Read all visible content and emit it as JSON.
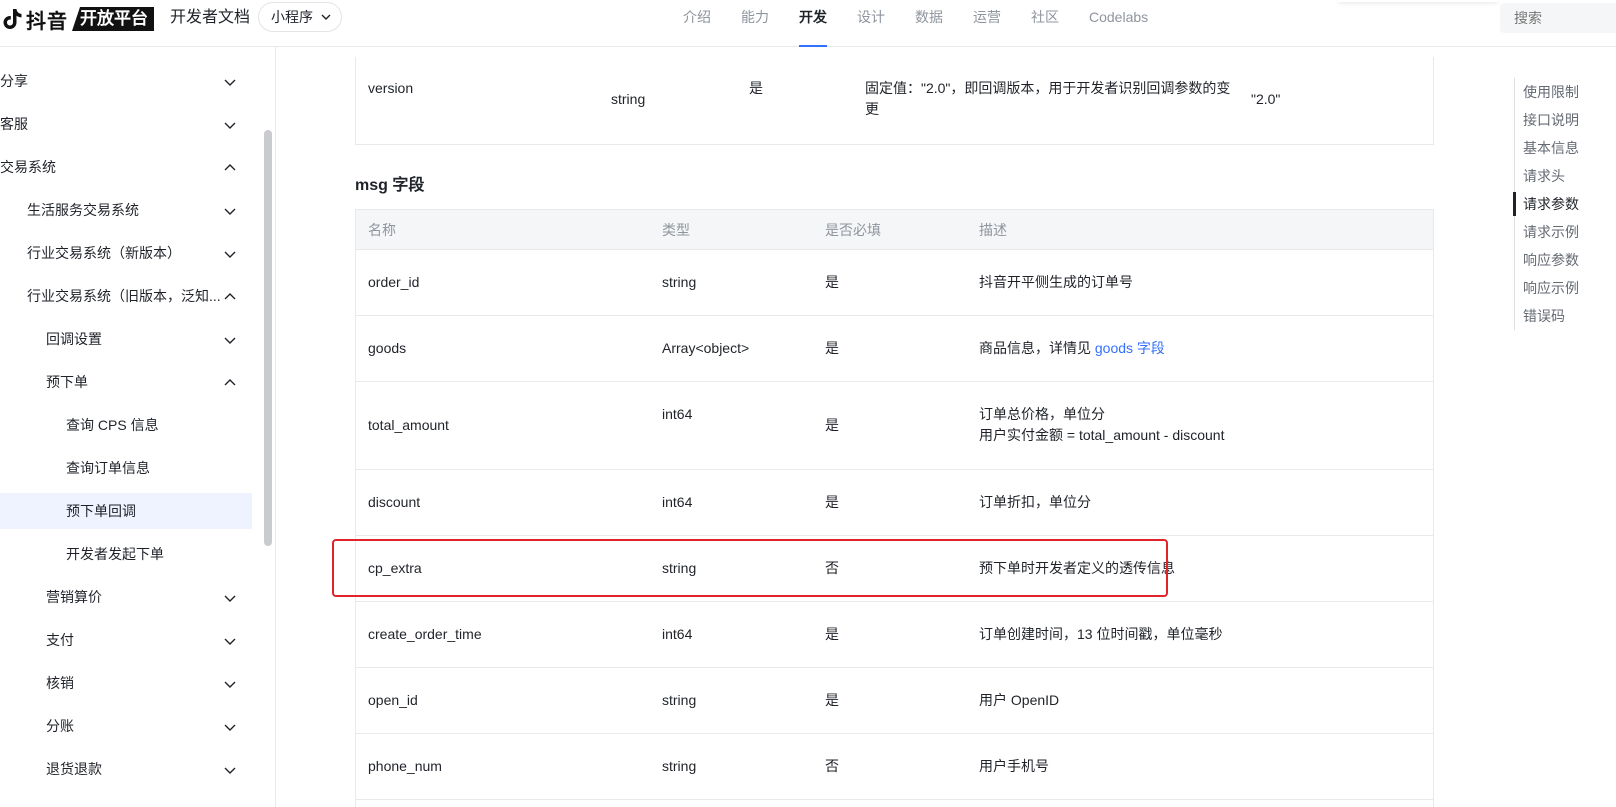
{
  "header": {
    "logo_text": "抖音",
    "logo_badge": "开放平台",
    "doc_title": "开发者文档",
    "product_select": "小程序",
    "nav": [
      {
        "label": "介绍",
        "active": false
      },
      {
        "label": "能力",
        "active": false
      },
      {
        "label": "开发",
        "active": true
      },
      {
        "label": "设计",
        "active": false
      },
      {
        "label": "数据",
        "active": false
      },
      {
        "label": "运营",
        "active": false
      },
      {
        "label": "社区",
        "active": false
      },
      {
        "label": "Codelabs",
        "active": false
      }
    ],
    "search_placeholder": "搜索"
  },
  "sidebar": {
    "items": [
      {
        "label": "分享",
        "expanded": false
      },
      {
        "label": "客服",
        "expanded": false
      },
      {
        "label": "交易系统",
        "expanded": true
      },
      {
        "label": "生活服务交易系统",
        "expanded": false
      },
      {
        "label": "行业交易系统（新版本）",
        "expanded": false
      },
      {
        "label": "行业交易系统（旧版本，泛知...",
        "expanded": true
      },
      {
        "label": "回调设置",
        "expanded": false
      },
      {
        "label": "预下单",
        "expanded": true
      },
      {
        "label": "查询 CPS 信息"
      },
      {
        "label": "查询订单信息"
      },
      {
        "label": "预下单回调",
        "selected": true
      },
      {
        "label": "开发者发起下单"
      },
      {
        "label": "营销算价",
        "expanded": false
      },
      {
        "label": "支付",
        "expanded": false
      },
      {
        "label": "核销",
        "expanded": false
      },
      {
        "label": "分账",
        "expanded": false
      },
      {
        "label": "退货退款",
        "expanded": false
      }
    ]
  },
  "top_row": {
    "name": "version",
    "type": "string",
    "required": "是",
    "desc_line1": "固定值：\"2.0\"，即回调版本，用于开发者识别回调参数的变",
    "desc_line2": "更",
    "example": "\"2.0\""
  },
  "msg_section": {
    "title": "msg 字段",
    "headers": [
      "名称",
      "类型",
      "是否必填",
      "描述"
    ],
    "rows": [
      {
        "name": "order_id",
        "type": "string",
        "required": "是",
        "desc": "抖音开平侧生成的订单号"
      },
      {
        "name": "goods",
        "type": "Array<object>",
        "required": "是",
        "desc": "商品信息，详情见 ",
        "link": "goods 字段"
      },
      {
        "name": "total_amount",
        "type": "int64",
        "required": "是",
        "desc": "订单总价格，单位分",
        "desc2": "用户实付金额 = total_amount - discount"
      },
      {
        "name": "discount",
        "type": "int64",
        "required": "是",
        "desc": "订单折扣，单位分"
      },
      {
        "name": "cp_extra",
        "type": "string",
        "required": "否",
        "desc": "预下单时开发者定义的透传信息"
      },
      {
        "name": "create_order_time",
        "type": "int64",
        "required": "是",
        "desc": "订单创建时间，13 位时间戳，单位毫秒"
      },
      {
        "name": "open_id",
        "type": "string",
        "required": "是",
        "desc": "用户 OpenID"
      },
      {
        "name": "phone_num",
        "type": "string",
        "required": "否",
        "desc": "用户手机号"
      }
    ]
  },
  "toc": {
    "items": [
      {
        "label": "使用限制"
      },
      {
        "label": "接口说明"
      },
      {
        "label": "基本信息"
      },
      {
        "label": "请求头"
      },
      {
        "label": "请求参数",
        "active": true
      },
      {
        "label": "请求示例"
      },
      {
        "label": "响应参数"
      },
      {
        "label": "响应示例"
      },
      {
        "label": "错误码"
      }
    ]
  },
  "colors": {
    "accent": "#3370ff",
    "highlight_box": "#e1242a",
    "selected_bg": "#eef3ff"
  }
}
